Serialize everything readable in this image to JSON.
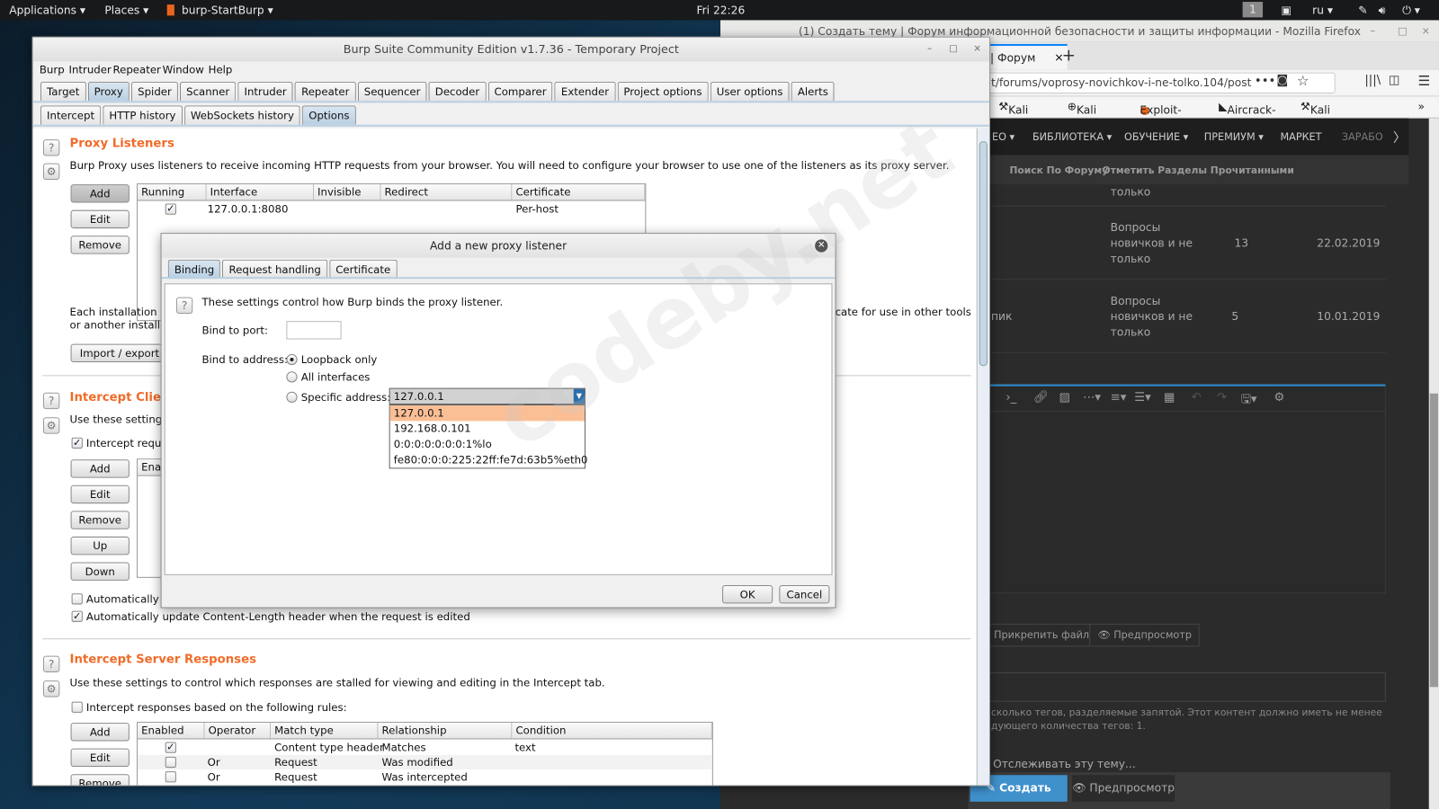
{
  "topbar": {
    "applications": "Applications ▾",
    "places": "Places ▾",
    "app": "burp-StartBurp ▾",
    "clock": "Fri 22:26",
    "workspace": "1",
    "lang": "ru ▾"
  },
  "firefox": {
    "title": "(1) Создать тему | Форум информационной безопасности и защиты информации - Mozilla Firefox",
    "tab_label": "| Форум",
    "url": "t/forums/voprosy-novichkov-i-ne-tolko.104/post",
    "bookmarks": [
      "Kali Docs",
      "Kali Tools",
      "Exploit-DB",
      "Aircrack-ng",
      "Kali Forums"
    ],
    "nav": [
      "ЕО ▾",
      "БИБЛИОТЕКА ▾",
      "ОБУЧЕНИЕ ▾",
      "ПРЕМИУМ ▾",
      "МАРКЕТ",
      "ЗАРАБО"
    ],
    "subnav": [
      "Поиск По Форуму",
      "Отметить Разделы Прочитанными"
    ],
    "rows": [
      {
        "author": "",
        "forum": "только",
        "replies": "",
        "date": ""
      },
      {
        "author": "",
        "forum": "Вопросы новичков и не только",
        "replies": "13",
        "date": "22.02.2019"
      },
      {
        "author": "пик",
        "forum": "Вопросы новичков и не только",
        "replies": "5",
        "date": "10.01.2019"
      }
    ],
    "attach_label": "Прикрепить файлы",
    "preview_label": "Предпросмотр",
    "tags_hint_1": "сколько тегов, разделяемые запятой. Этот контент должно иметь не менее",
    "tags_hint_2": "дующего количества тегов: 1.",
    "watch_label": "Отслеживать эту тему...",
    "create_label": "Создать тему",
    "preview2_label": "Предпросмотр"
  },
  "burp": {
    "title": "Burp Suite Community Edition v1.7.36 - Temporary Project",
    "menu": [
      "Burp",
      "Intruder",
      "Repeater",
      "Window",
      "Help"
    ],
    "tabs": [
      "Target",
      "Proxy",
      "Spider",
      "Scanner",
      "Intruder",
      "Repeater",
      "Sequencer",
      "Decoder",
      "Comparer",
      "Extender",
      "Project options",
      "User options",
      "Alerts"
    ],
    "active_tab": "Proxy",
    "subtabs": [
      "Intercept",
      "HTTP history",
      "WebSockets history",
      "Options"
    ],
    "active_subtab": "Options",
    "listeners": {
      "heading": "Proxy Listeners",
      "desc": "Burp Proxy uses listeners to receive incoming HTTP requests from your browser. You will need to configure your browser to use one of the listeners as its proxy server.",
      "buttons": [
        "Add",
        "Edit",
        "Remove"
      ],
      "columns": [
        "Running",
        "Interface",
        "Invisible",
        "Redirect",
        "Certificate"
      ],
      "rows": [
        {
          "running": true,
          "interface": "127.0.0.1:8080",
          "invisible": "",
          "redirect": "",
          "certificate": "Per-host"
        }
      ],
      "ca_text_1": "Each installation o",
      "ca_text_2": "or another installat",
      "ca_text_right": "cate for use in other tools",
      "import_label": "Import / export C"
    },
    "client": {
      "heading": "Intercept Clien",
      "desc": "Use these settings",
      "intercept_label": "Intercept reque",
      "buttons": [
        "Add",
        "Edit",
        "Remove",
        "Up",
        "Down"
      ],
      "column": "Enab",
      "auto_fix": "Automatically f",
      "auto_update": "Automatically update Content-Length header when the request is edited"
    },
    "server": {
      "heading": "Intercept Server Responses",
      "desc": "Use these settings to control which responses are stalled for viewing and editing in the Intercept tab.",
      "intercept_label": "Intercept responses based on the following rules:",
      "buttons": [
        "Add",
        "Edit",
        "Remove"
      ],
      "columns": [
        "Enabled",
        "Operator",
        "Match type",
        "Relationship",
        "Condition"
      ],
      "rows": [
        {
          "enabled": true,
          "operator": "",
          "match": "Content type header",
          "rel": "Matches",
          "cond": "text"
        },
        {
          "enabled": false,
          "operator": "Or",
          "match": "Request",
          "rel": "Was modified",
          "cond": ""
        },
        {
          "enabled": false,
          "operator": "Or",
          "match": "Request",
          "rel": "Was intercepted",
          "cond": ""
        }
      ]
    }
  },
  "dialog": {
    "title": "Add a new proxy listener",
    "tabs": [
      "Binding",
      "Request handling",
      "Certificate"
    ],
    "intro": "These settings control how Burp binds the proxy listener.",
    "port_label": "Bind to port:",
    "port_value": "",
    "address_label": "Bind to address:",
    "options": [
      "Loopback only",
      "All interfaces",
      "Specific address:"
    ],
    "selected_option": "Loopback only",
    "combo_value": "127.0.0.1",
    "addresses": [
      "127.0.0.1",
      "192.168.0.101",
      "0:0:0:0:0:0:0:1%lo",
      "fe80:0:0:0:225:22ff:fe7d:63b5%eth0"
    ],
    "ok": "OK",
    "cancel": "Cancel"
  },
  "watermark": "codeby.net"
}
